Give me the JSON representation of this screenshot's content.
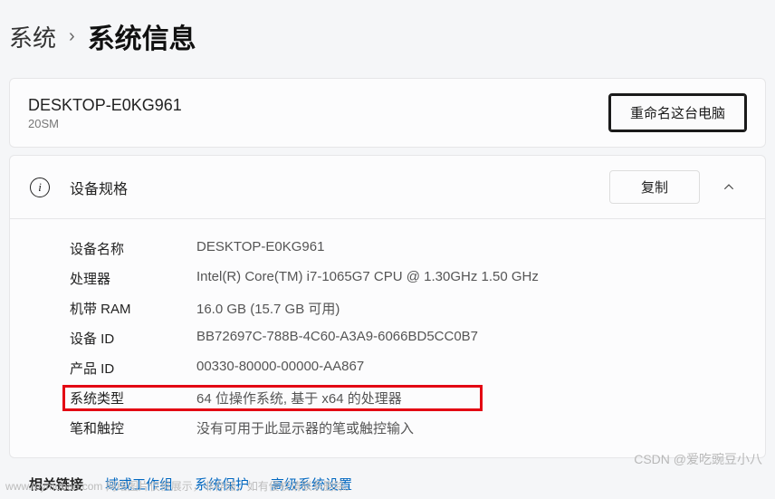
{
  "breadcrumb": {
    "parent": "系统",
    "current": "系统信息"
  },
  "device": {
    "name": "DESKTOP-E0KG961",
    "sub": "20SM",
    "rename": "重命名这台电脑"
  },
  "spec": {
    "title": "设备规格",
    "copy": "复制",
    "rows": [
      {
        "label": "设备名称",
        "value": "DESKTOP-E0KG961"
      },
      {
        "label": "处理器",
        "value": "Intel(R) Core(TM) i7-1065G7 CPU @ 1.30GHz   1.50 GHz"
      },
      {
        "label": "机带 RAM",
        "value": "16.0 GB (15.7 GB 可用)"
      },
      {
        "label": "设备 ID",
        "value": "BB72697C-788B-4C60-A3A9-6066BD5CC0B7"
      },
      {
        "label": "产品 ID",
        "value": "00330-80000-00000-AA867"
      },
      {
        "label": "系统类型",
        "value": "64 位操作系统, 基于 x64 的处理器"
      },
      {
        "label": "笔和触控",
        "value": "没有可用于此显示器的笔或触控输入"
      }
    ]
  },
  "links": {
    "title": "相关链接",
    "items": [
      "域或工作组",
      "系统保护",
      "高级系统设置"
    ]
  },
  "watermark_br": "CSDN @爱吃豌豆小八",
  "watermark_bl": "www.toymoban.com 网络图片仅供展示，非存储，如有侵权请联系删除。"
}
